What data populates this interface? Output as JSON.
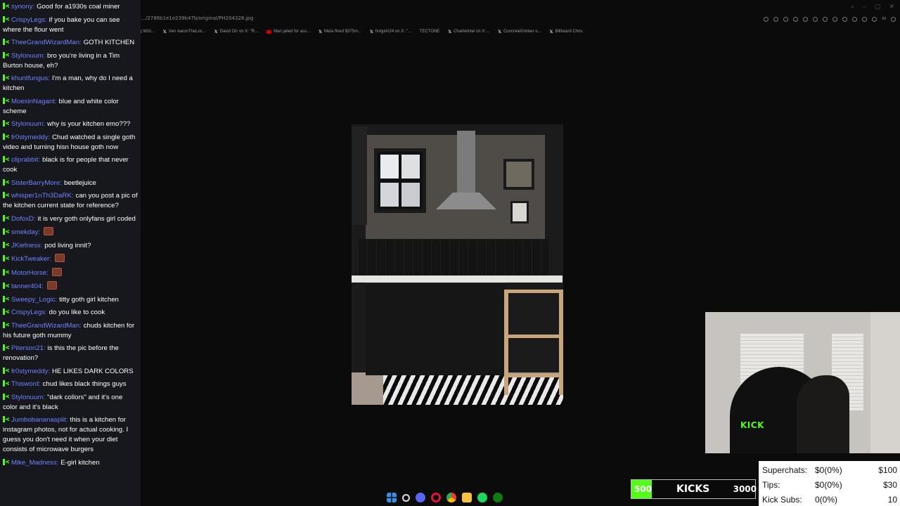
{
  "browser": {
    "url": "…/2786b1e1e239b47b/original/PH204328.jpg",
    "bookmarks": [
      {
        "icon": "x",
        "label": "Investigating Wizt..."
      },
      {
        "icon": "x",
        "label": "Xen AaronTheLoc..."
      },
      {
        "icon": "x",
        "label": "David Orr on X: \"R..."
      },
      {
        "icon": "youtube",
        "label": "Man jailed for ass..."
      },
      {
        "icon": "x",
        "label": "Meta fined $375m..."
      },
      {
        "icon": "x",
        "label": "hotgirl#24 on X: \"..."
      },
      {
        "icon": "none",
        "label": "TECTONE"
      },
      {
        "icon": "x",
        "label": "CharlieIntel on X:..."
      },
      {
        "icon": "x",
        "label": "ConcreteDrinker o..."
      },
      {
        "icon": "x",
        "label": "Billboard Chris"
      }
    ],
    "ai_label": "AI"
  },
  "chat": {
    "messages": [
      {
        "user": "synony",
        "text": "Good for a1930s coal miner"
      },
      {
        "user": "CrispyLegs",
        "text": "if you bake you can see where the flour went"
      },
      {
        "user": "TheeGrandWizardMan",
        "text": "GOTH KITCHEN"
      },
      {
        "user": "Stylonuum",
        "text": "bro you're living in a Tim Burton house, eh?"
      },
      {
        "user": "khuntfungus",
        "text": "I'm a man, why do I need a kitchen"
      },
      {
        "user": "MoesinNagant",
        "text": "blue and white color scheme"
      },
      {
        "user": "Stylonuum",
        "text": "why is your kitchen emo???"
      },
      {
        "user": "fr0stymeddy",
        "text": "Chud watched a single goth video and turning hisn house goth now"
      },
      {
        "user": "cliprabbit",
        "text": "black is for people that never cook"
      },
      {
        "user": "SisterBarryMore",
        "text": "beetlejuice"
      },
      {
        "user": "whisper1nTh3DaRK",
        "text": "can you post a pic of the kitchen current state for reference?"
      },
      {
        "user": "DofoxD",
        "text": "it is very goth onlyfans girl coded"
      },
      {
        "user": "smekday",
        "text": "",
        "emote": true
      },
      {
        "user": "JKiefness",
        "text": "pod living innit?"
      },
      {
        "user": "KickTweaker",
        "text": "",
        "emote": true
      },
      {
        "user": "MotorHorse",
        "text": "",
        "emote": true
      },
      {
        "user": "tanner404",
        "text": "",
        "emote": true
      },
      {
        "user": "Sweepy_Logic",
        "text": "titty goth girl kitchen"
      },
      {
        "user": "CrispyLegs",
        "text": "do you like to cook"
      },
      {
        "user": "TheeGrandWizardMan",
        "text": "chuds kitchen for his future goth mummy"
      },
      {
        "user": "Piterson21",
        "text": "is this the pic before the renovation?"
      },
      {
        "user": "fr0stymeddy",
        "text": "HE LIKES DARK COLORS"
      },
      {
        "user": "Thisword",
        "text": "chud likes black things guys"
      },
      {
        "user": "Stylonuum",
        "text": "\"dark collors\" and it's one color and it's black"
      },
      {
        "user": "Jumbobananasplit",
        "text": "this is a kitchen for instagram photos, not for actual cooking. I guess you don't need it when your diet consists of microwave burgers"
      },
      {
        "user": "Mike_Madness",
        "text": "E-girl kitchen"
      }
    ]
  },
  "webcam": {
    "cap_logo": "KICK"
  },
  "kicks": {
    "left": "500",
    "title": "KICKS",
    "right": "3000",
    "progress": 0.167,
    "color": "#53fc18"
  },
  "stats": [
    {
      "label": "Superchats:",
      "value": "$0(0%)",
      "goal": "$100"
    },
    {
      "label": "Tips:",
      "value": "$0(0%)",
      "goal": "$30"
    },
    {
      "label": "Kick Subs:",
      "value": "0(0%)",
      "goal": "10"
    }
  ],
  "taskbar": {
    "icons": [
      "windows-icon",
      "search-icon",
      "discord-icon",
      "opera-gx-icon",
      "chrome-icon",
      "file-explorer-icon",
      "spotify-icon",
      "xbox-icon"
    ]
  }
}
